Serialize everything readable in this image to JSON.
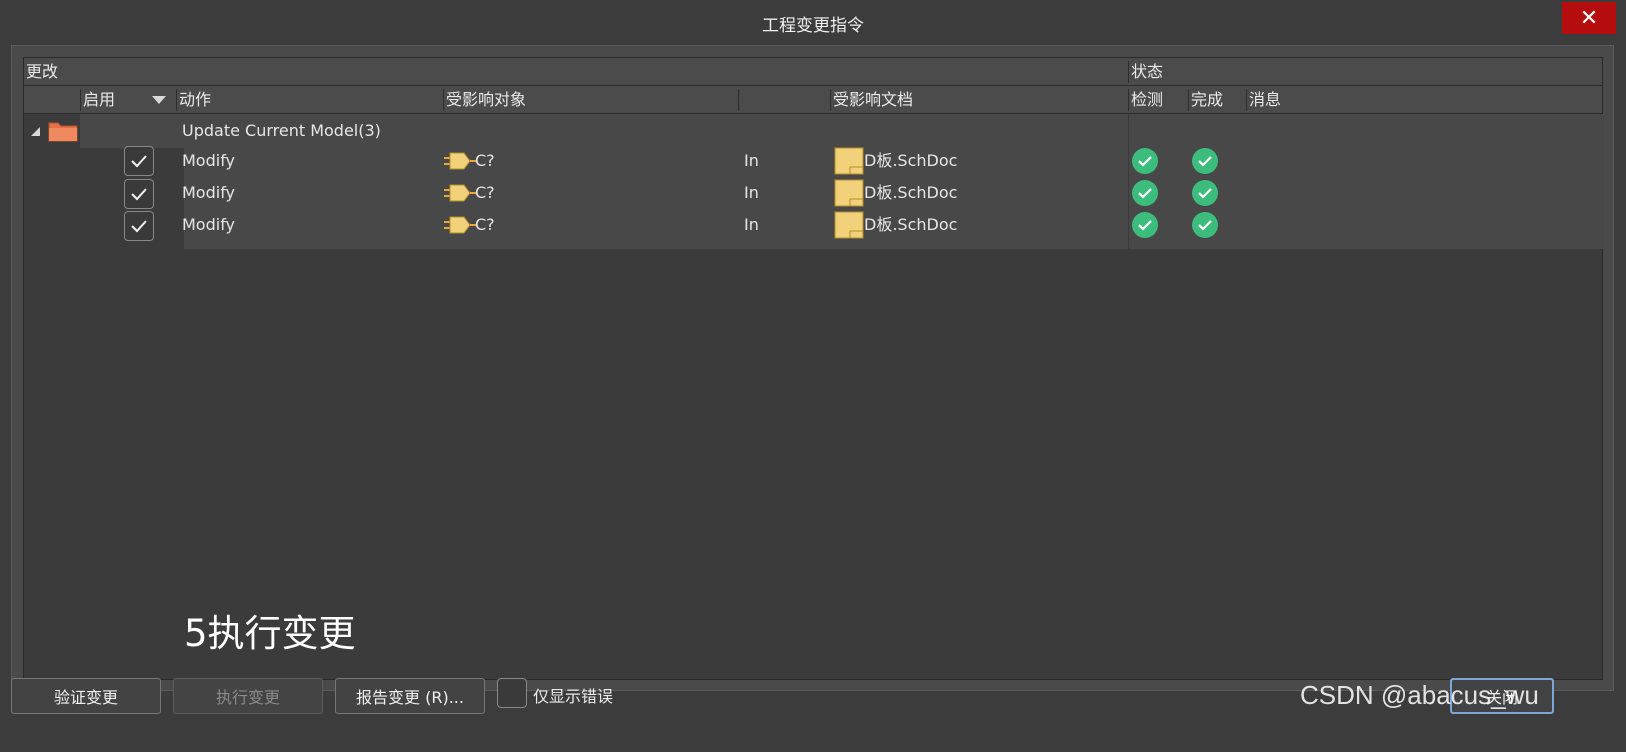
{
  "window": {
    "title": "工程变更指令",
    "close_glyph": "✕"
  },
  "header": {
    "group_changes": "更改",
    "group_status": "状态",
    "col_enable": "启用",
    "col_action": "动作",
    "col_affected_object": "受影响对象",
    "col_affected_document": "受影响文档",
    "col_check": "检测",
    "col_done": "完成",
    "col_message": "消息"
  },
  "group": {
    "label": "Update Current Model(3)",
    "expanded": true
  },
  "rows": [
    {
      "enabled": true,
      "action": "Modify",
      "object": "C?",
      "relation": "In",
      "document": "D板.SchDoc",
      "check": "ok",
      "done": "ok"
    },
    {
      "enabled": true,
      "action": "Modify",
      "object": "C?",
      "relation": "In",
      "document": "D板.SchDoc",
      "check": "ok",
      "done": "ok"
    },
    {
      "enabled": true,
      "action": "Modify",
      "object": "C?",
      "relation": "In",
      "document": "D板.SchDoc",
      "check": "ok",
      "done": "ok"
    }
  ],
  "annotation": "5执行变更",
  "footer": {
    "validate_label": "验证变更",
    "execute_label": "执行变更",
    "report_label": "报告变更 (R)...",
    "errors_only_label": "仅显示错误",
    "close_label": "关闭",
    "errors_only_checked": false
  },
  "watermark": "CSDN @abacus_wu",
  "colors": {
    "background": "#3c3c3c",
    "close_button": "#b50d0d",
    "success": "#3dbd7d",
    "folder": "#e2704a",
    "doc_icon": "#f1d27a"
  }
}
